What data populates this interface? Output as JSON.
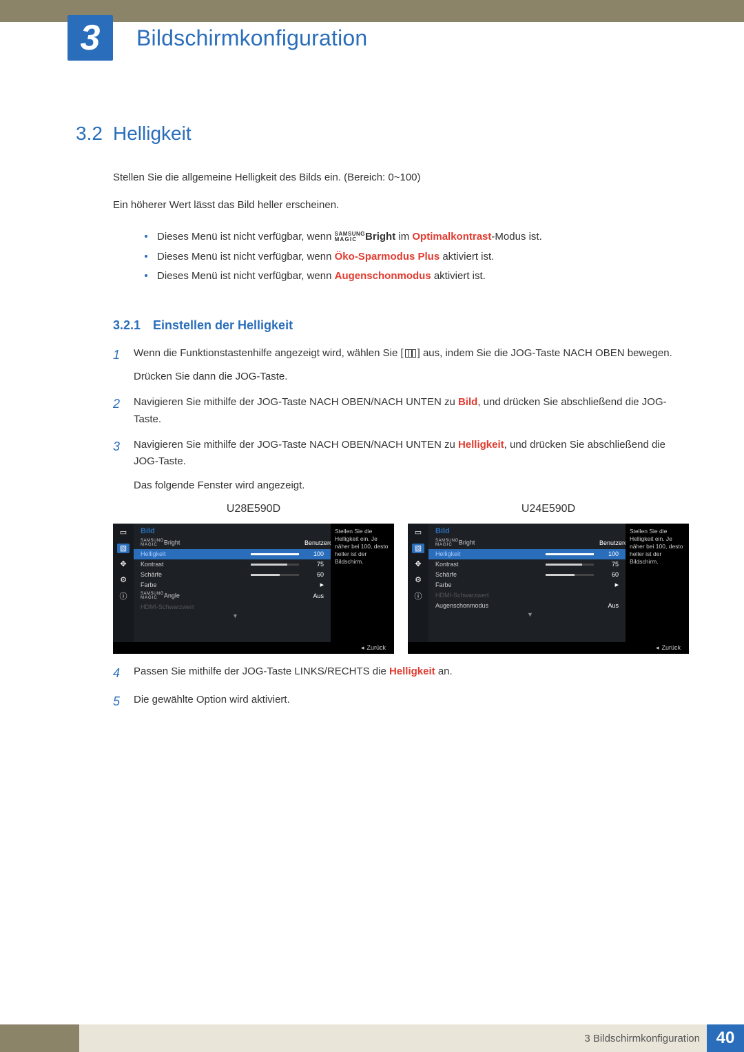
{
  "chapter": {
    "number": "3",
    "title": "Bildschirmkonfiguration"
  },
  "section": {
    "number": "3.2",
    "title": "Helligkeit"
  },
  "intro": {
    "p1": "Stellen Sie die allgemeine Helligkeit des Bilds ein. (Bereich: 0~100)",
    "p2": "Ein höherer Wert lässt das Bild heller erscheinen."
  },
  "notes": {
    "n1": {
      "pre": "Dieses Menü ist nicht verfügbar, wenn ",
      "magic_top": "SAMSUNG",
      "magic_bot": "MAGIC",
      "magic_suf": "Bright",
      "mid": " im ",
      "key": "Optimalkontrast",
      "post": "-Modus ist."
    },
    "n2": {
      "pre": "Dieses Menü ist nicht verfügbar, wenn ",
      "key": "Öko-Sparmodus Plus",
      "post": " aktiviert ist."
    },
    "n3": {
      "pre": "Dieses Menü ist nicht verfügbar, wenn ",
      "key": "Augenschonmodus",
      "post": " aktiviert ist."
    }
  },
  "subsection": {
    "number": "3.2.1",
    "title": "Einstellen der Helligkeit"
  },
  "steps": {
    "s1": {
      "num": "1",
      "a": "Wenn die Funktionstastenhilfe angezeigt wird, wählen Sie [",
      "b": "] aus, indem Sie die JOG-Taste NACH OBEN bewegen.",
      "c": "Drücken Sie dann die JOG-Taste."
    },
    "s2": {
      "num": "2",
      "a": "Navigieren Sie mithilfe der JOG-Taste NACH OBEN/NACH UNTEN zu ",
      "k": "Bild",
      "b": ", und drücken Sie abschließend die JOG-Taste."
    },
    "s3": {
      "num": "3",
      "a": "Navigieren Sie mithilfe der JOG-Taste NACH OBEN/NACH UNTEN zu ",
      "k": "Helligkeit",
      "b": ", und drücken Sie abschließend die JOG-Taste.",
      "c": "Das folgende Fenster wird angezeigt."
    },
    "s4": {
      "num": "4",
      "a": "Passen Sie mithilfe der JOG-Taste LINKS/RECHTS die ",
      "k": "Helligkeit",
      "b": " an."
    },
    "s5": {
      "num": "5",
      "a": "Die gewählte Option wird aktiviert."
    }
  },
  "osd": [
    {
      "model": "U28E590D",
      "title": "Bild",
      "help": "Stellen Sie die Helligkeit ein. Je näher bei 100, desto heller ist der Bildschirm.",
      "back": "Zurück",
      "sideSel": 1,
      "rows": [
        {
          "kind": "magic",
          "top": "SAMSUNG",
          "bot": "MAGIC",
          "suf": "Bright",
          "val": "Benutzerdef."
        },
        {
          "kind": "hl",
          "label": "Helligkeit",
          "bar": 100,
          "val": "100"
        },
        {
          "kind": "n",
          "label": "Kontrast",
          "bar": 75,
          "val": "75"
        },
        {
          "kind": "n",
          "label": "Schärfe",
          "bar": 60,
          "val": "60"
        },
        {
          "kind": "arrow",
          "label": "Farbe"
        },
        {
          "kind": "magic",
          "top": "SAMSUNG",
          "bot": "MAGIC",
          "suf": "Angle",
          "val": "Aus"
        },
        {
          "kind": "dis",
          "label": "HDMI-Schwarzwert"
        }
      ]
    },
    {
      "model": "U24E590D",
      "title": "Bild",
      "help": "Stellen Sie die Helligkeit ein. Je näher bei 100, desto heller ist der Bildschirm.",
      "back": "Zurück",
      "sideSel": 1,
      "rows": [
        {
          "kind": "magic",
          "top": "SAMSUNG",
          "bot": "MAGIC",
          "suf": "Bright",
          "val": "Benutzerdef."
        },
        {
          "kind": "hl",
          "label": "Helligkeit",
          "bar": 100,
          "val": "100"
        },
        {
          "kind": "n",
          "label": "Kontrast",
          "bar": 75,
          "val": "75"
        },
        {
          "kind": "n",
          "label": "Schärfe",
          "bar": 60,
          "val": "60"
        },
        {
          "kind": "arrow",
          "label": "Farbe"
        },
        {
          "kind": "dis",
          "label": "HDMI-Schwarzwert"
        },
        {
          "kind": "n",
          "label": "Augenschonmodus",
          "val": "Aus"
        }
      ]
    }
  ],
  "footer": {
    "chapnum": "3",
    "chaptitle": "Bildschirmkonfiguration",
    "page": "40"
  }
}
